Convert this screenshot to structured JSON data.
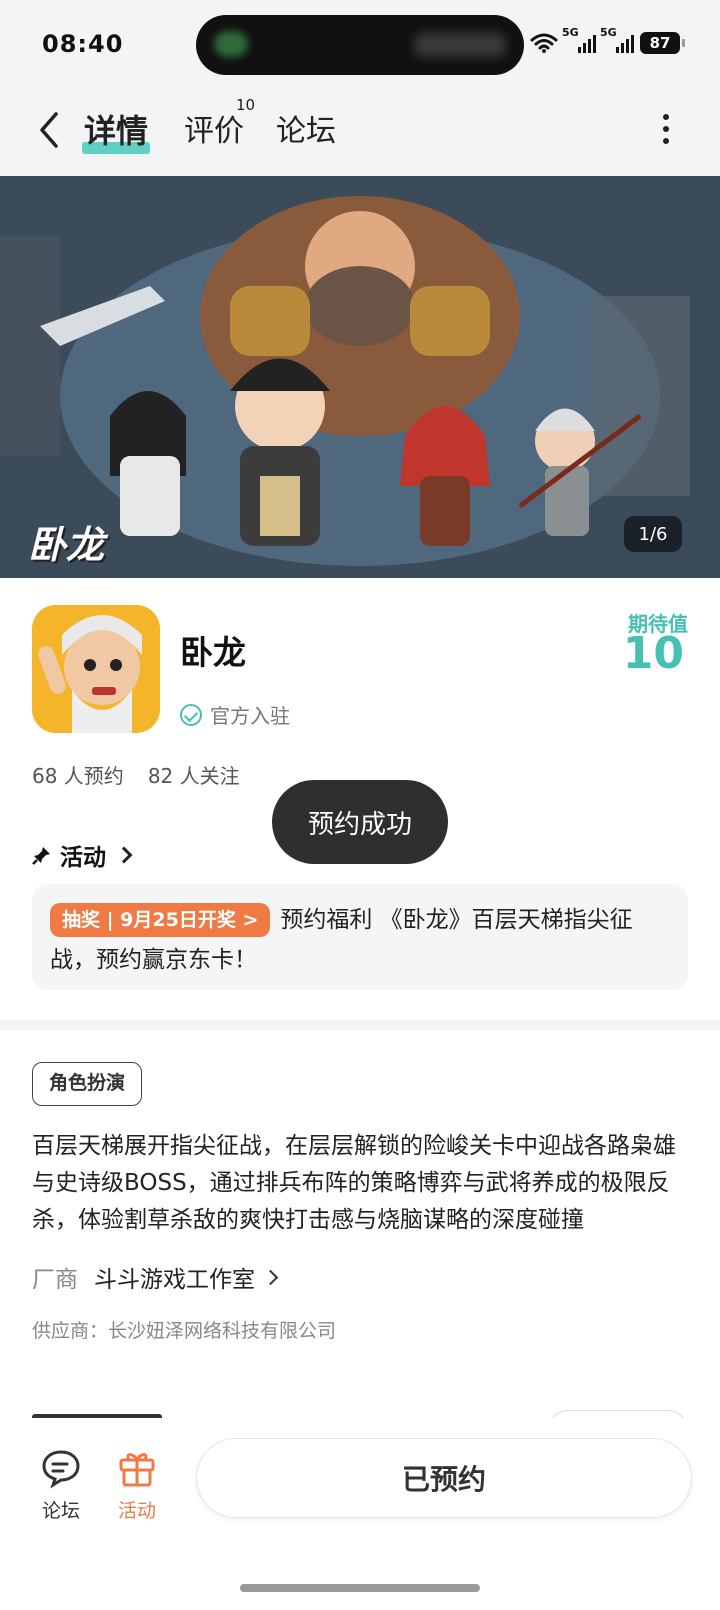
{
  "status_bar": {
    "time": "08:40",
    "signal1": "5G",
    "signal2": "5G",
    "battery": "87"
  },
  "nav": {
    "tabs": [
      {
        "label": "详情",
        "active": true
      },
      {
        "label": "评价",
        "count": "10"
      },
      {
        "label": "论坛"
      }
    ]
  },
  "banner": {
    "logo_text": "卧龙",
    "counter": "1/6"
  },
  "app": {
    "name": "卧龙",
    "official_label": "官方入驻",
    "expect_label": "期待值",
    "expect_value": "10",
    "reservations": "68 人预约",
    "followers": "82 人关注"
  },
  "toast": "预约成功",
  "activity": {
    "heading": "活动",
    "badge": "抽奖 | 9月25日开奖 >",
    "text": "预约福利 《卧龙》百层天梯指尖征战，预约赢京东卡！"
  },
  "details": {
    "genre_tag": "角色扮演",
    "description": "百层天梯展开指尖征战，在层层解锁的险峻关卡中迎战各路枭雄与史诗级BOSS，通过排兵布阵的策略博弈与武将养成的极限反杀，体验割草杀敌的爽快打击感与烧脑谋略的深度碰撞",
    "vendor_label": "厂商",
    "vendor_name": "斗斗游戏工作室",
    "supplier": "供应商：长沙妞泽网络科技有限公司"
  },
  "bottom_bar": {
    "forum_label": "论坛",
    "activity_label": "活动",
    "reserve_button": "已预约"
  },
  "colors": {
    "accent_teal": "#45c0b3",
    "accent_orange": "#f07a44"
  }
}
